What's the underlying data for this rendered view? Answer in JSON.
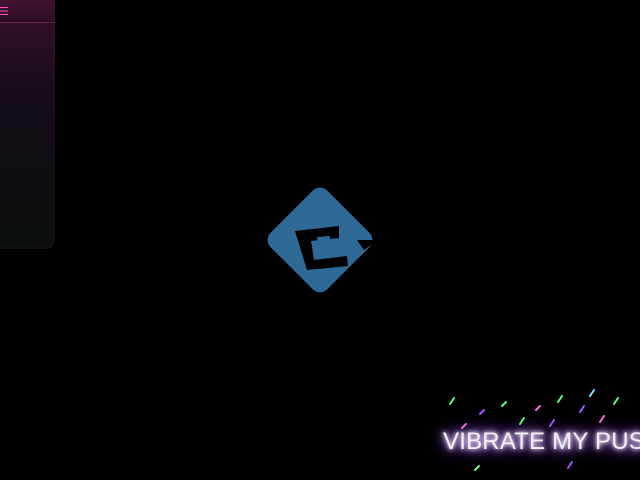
{
  "side_panel": {
    "icon": "menu-icon",
    "accent": "#ff4fbf"
  },
  "logo": {
    "icon": "e-logo-icon",
    "color": "#2f6a97"
  },
  "marquee": {
    "text": "VIBRATE MY PUS",
    "glow": "#b072ff"
  },
  "confetti": {
    "colors": [
      "#5dff7a",
      "#a259ff",
      "#ff6fd8",
      "#7fe8ff"
    ]
  }
}
